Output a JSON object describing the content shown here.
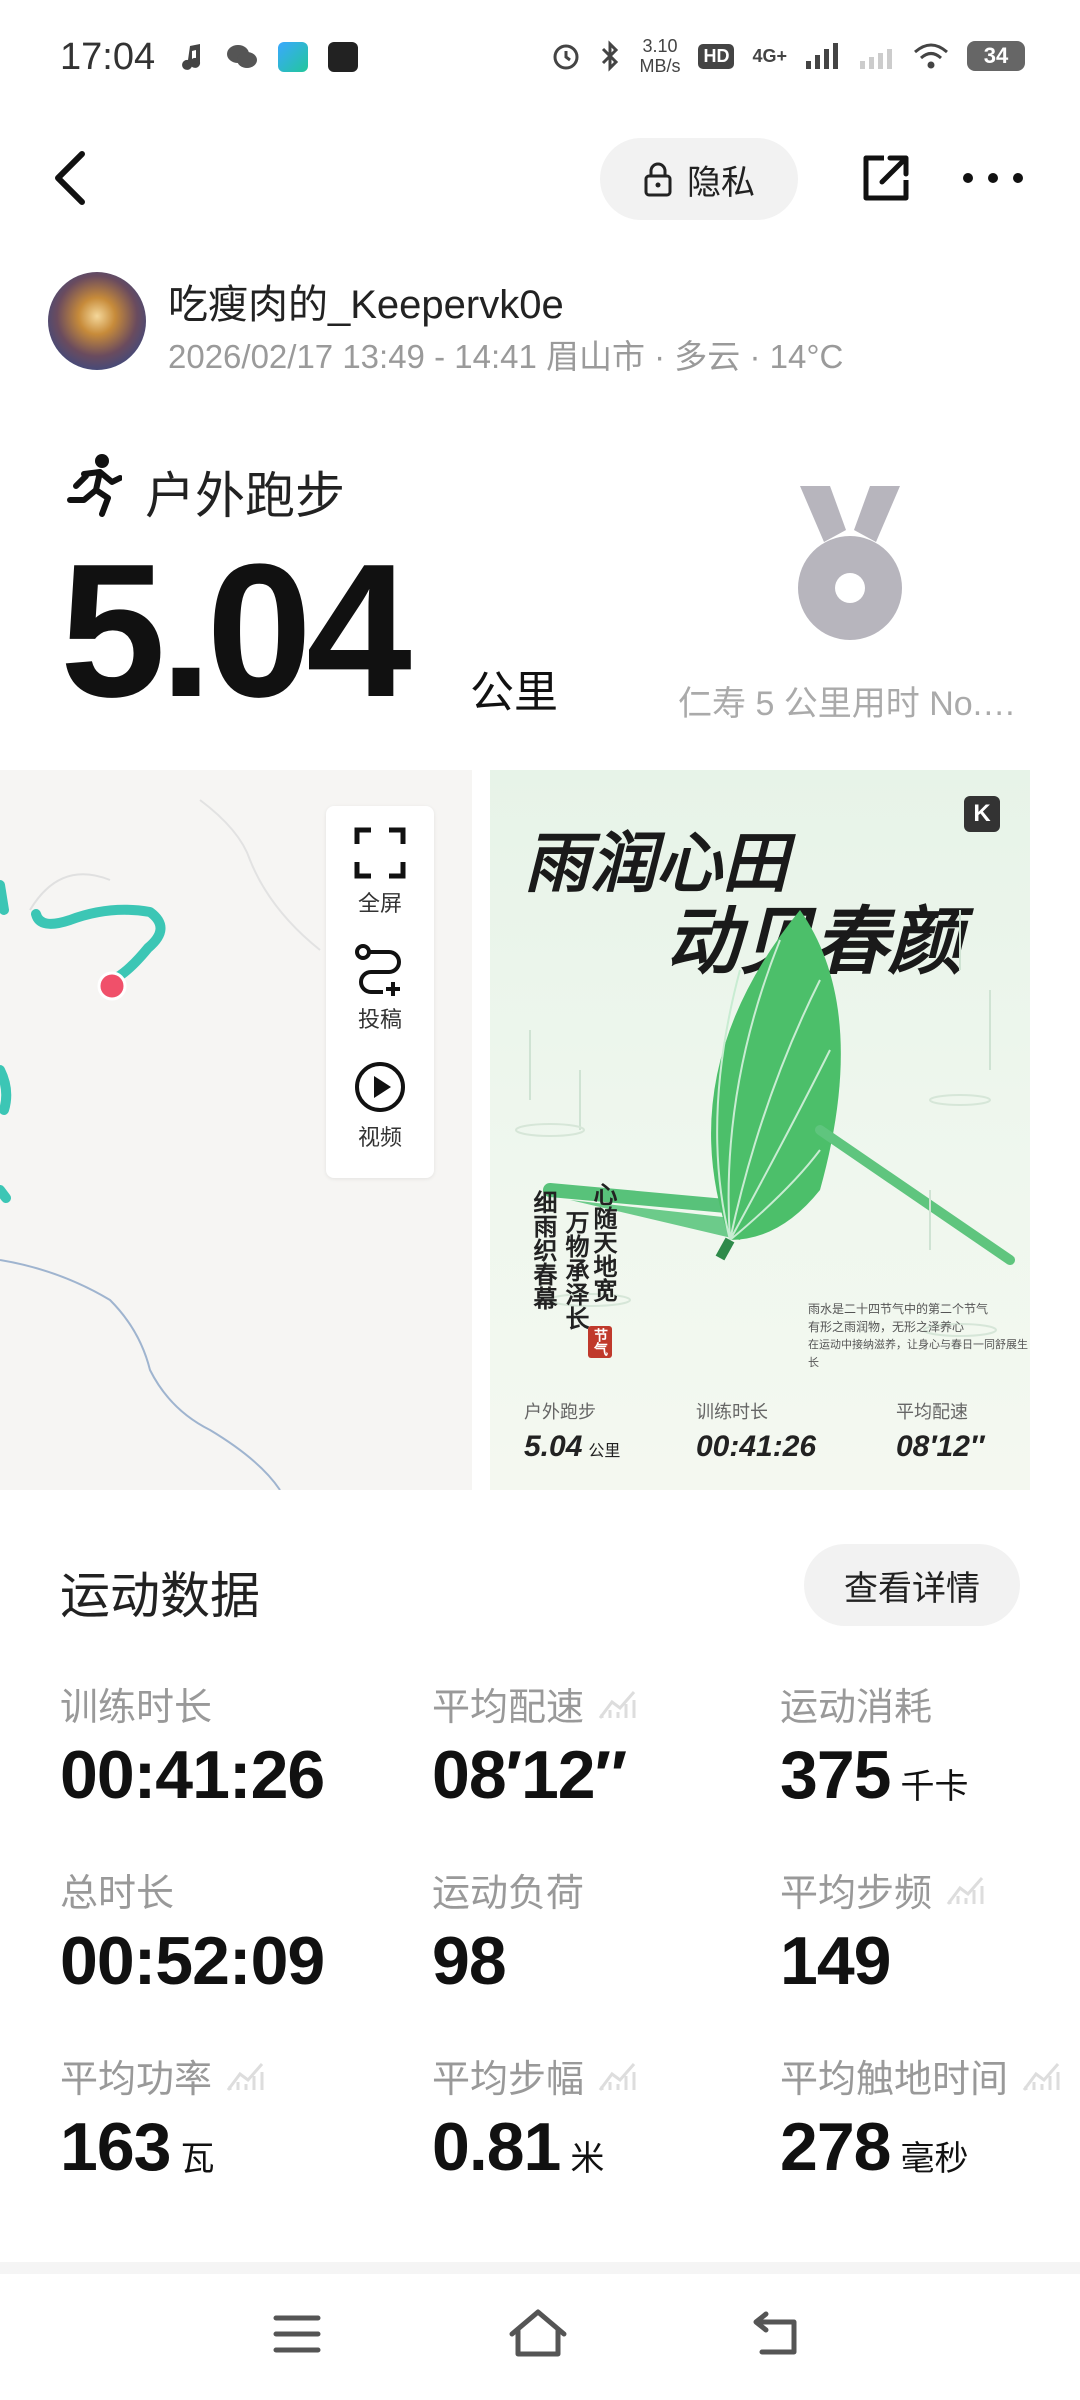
{
  "status_bar": {
    "time": "17:04",
    "net_speed_value": "3.10",
    "net_speed_unit": "MB/s",
    "battery": "34",
    "hd_badge": "HD",
    "signal_label": "4G+"
  },
  "header": {
    "privacy_label": "隐私"
  },
  "user": {
    "name": "吃瘦肉的_Keepervk0e",
    "meta": "2026/02/17 13:49 - 14:41 眉山市 · 多云 · 14°C"
  },
  "workout": {
    "type": "户外跑步",
    "distance": "5.04",
    "distance_unit": "公里",
    "medal_text": "仁寿 5 公里用时 No.…"
  },
  "map_tools": {
    "fullscreen": "全屏",
    "submit": "投稿",
    "video": "视频"
  },
  "poster": {
    "logo": "K",
    "headline_1": "雨润心田",
    "headline_2": "动见春颜",
    "poem_1": "心随天地宽",
    "poem_2": "万物承泽长",
    "poem_3": "细雨织春幕",
    "seal": "节气",
    "note_1": "雨水是二十四节气中的第二个节气",
    "note_2": "有形之雨润物，无形之泽养心",
    "note_3": "在运动中接纳滋养，让身心与春日一同舒展生长",
    "stat_1_label": "户外跑步",
    "stat_1_value": "5.04",
    "stat_1_unit": "公里",
    "stat_2_label": "训练时长",
    "stat_2_value": "00:41:26",
    "stat_3_label": "平均配速",
    "stat_3_value": "08′12″"
  },
  "stats": {
    "title": "运动数据",
    "detail_button": "查看详情",
    "items": [
      {
        "label": "训练时长",
        "value": "00:41:26",
        "unit": ""
      },
      {
        "label": "平均配速",
        "value": "08′12″",
        "unit": ""
      },
      {
        "label": "运动消耗",
        "value": "375",
        "unit": "千卡"
      },
      {
        "label": "总时长",
        "value": "00:52:09",
        "unit": ""
      },
      {
        "label": "运动负荷",
        "value": "98",
        "unit": ""
      },
      {
        "label": "平均步频",
        "value": "149",
        "unit": ""
      },
      {
        "label": "平均功率",
        "value": "163",
        "unit": "瓦"
      },
      {
        "label": "平均步幅",
        "value": "0.81",
        "unit": "米"
      },
      {
        "label": "平均触地时间",
        "value": "278",
        "unit": "毫秒"
      }
    ]
  },
  "colors": {
    "route": "#3cc6b5",
    "end_point": "#f0506a",
    "medal": "#b7b5bd",
    "umbrella": "#4cbf6a"
  }
}
